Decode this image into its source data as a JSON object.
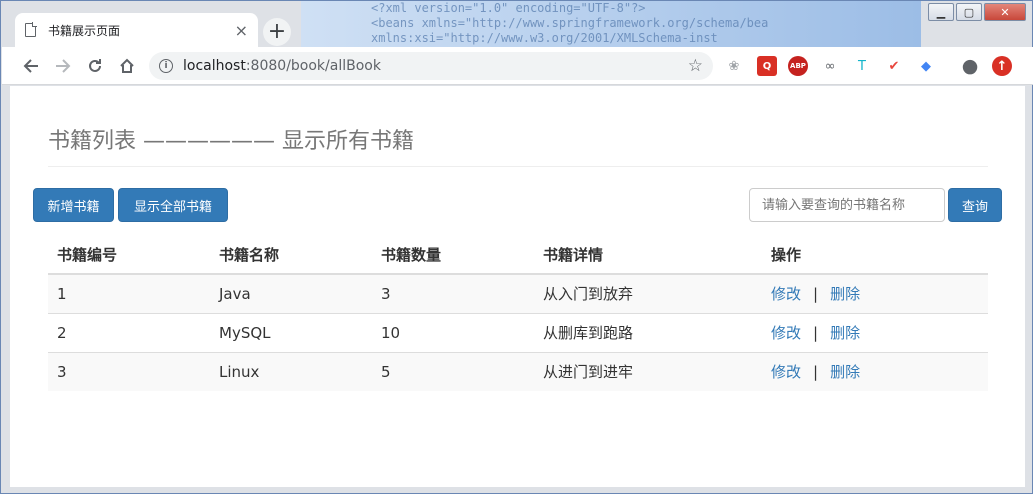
{
  "browser": {
    "tab_title": "书籍展示页面",
    "tab_close": "×",
    "new_tab": "+",
    "url_host": "localhost",
    "url_rest": ":8080/book/allBook",
    "window_controls": {
      "minimize": "▁",
      "maximize": "▢",
      "close": "✕"
    }
  },
  "extensions": [
    {
      "name": "weibo-icon",
      "glyph": "❀",
      "color": "#a0a4a8"
    },
    {
      "name": "search-ext-icon",
      "glyph": "Q",
      "color": "#d93025"
    },
    {
      "name": "abp-icon",
      "glyph": "ABP",
      "color": "#c5221f"
    },
    {
      "name": "infinity-icon",
      "glyph": "∞",
      "color": "#5f6368"
    },
    {
      "name": "translate-icon",
      "glyph": "T",
      "color": "#12b5cb"
    },
    {
      "name": "check-ext-icon",
      "glyph": "✔",
      "color": "#e8453c"
    },
    {
      "name": "cap-icon",
      "glyph": "◆",
      "color": "#4285f4"
    },
    {
      "name": "account-icon",
      "glyph": "●",
      "color": "#5f6368"
    },
    {
      "name": "update-icon",
      "glyph": "↑",
      "color": "#d93025"
    }
  ],
  "page": {
    "title": "书籍列表 —————— 显示所有书籍",
    "add_button": "新增书籍",
    "show_all_button": "显示全部书籍",
    "search_placeholder": "请输入要查询的书籍名称",
    "search_button": "查询"
  },
  "table": {
    "headers": [
      "书籍编号",
      "书籍名称",
      "书籍数量",
      "书籍详情",
      "操作"
    ],
    "rows": [
      {
        "id": "1",
        "name": "Java",
        "count": "3",
        "detail": "从入门到放弃",
        "edit": "修改",
        "sep": "|",
        "delete": "删除"
      },
      {
        "id": "2",
        "name": "MySQL",
        "count": "10",
        "detail": "从删库到跑路",
        "edit": "修改",
        "sep": "|",
        "delete": "删除"
      },
      {
        "id": "3",
        "name": "Linux",
        "count": "5",
        "detail": "从进门到进牢",
        "edit": "修改",
        "sep": "|",
        "delete": "删除"
      }
    ]
  }
}
